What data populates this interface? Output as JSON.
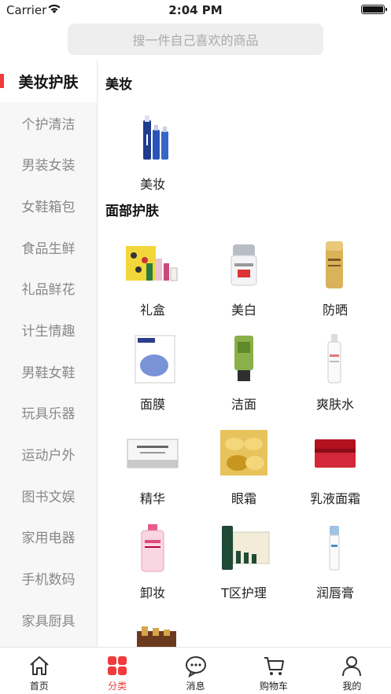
{
  "status_bar": {
    "carrier": "Carrier",
    "time": "2:04 PM"
  },
  "search": {
    "placeholder": "搜一件自己喜欢的商品"
  },
  "sidebar": {
    "items": [
      {
        "label": "美妆护肤",
        "active": true
      },
      {
        "label": "个护清洁"
      },
      {
        "label": "男装女装"
      },
      {
        "label": "女鞋箱包"
      },
      {
        "label": "食品生鲜"
      },
      {
        "label": "礼品鲜花"
      },
      {
        "label": "计生情趣"
      },
      {
        "label": "男鞋女鞋"
      },
      {
        "label": "玩具乐器"
      },
      {
        "label": "运动户外"
      },
      {
        "label": "图书文娱"
      },
      {
        "label": "家用电器"
      },
      {
        "label": "手机数码"
      },
      {
        "label": "家具厨具"
      }
    ]
  },
  "sections": [
    {
      "title": "美妆",
      "items": [
        {
          "label": "美妆"
        }
      ]
    },
    {
      "title": "面部护肤",
      "items": [
        {
          "label": "礼盒"
        },
        {
          "label": "美白"
        },
        {
          "label": "防晒"
        },
        {
          "label": "面膜"
        },
        {
          "label": "洁面"
        },
        {
          "label": "爽肤水"
        },
        {
          "label": "精华"
        },
        {
          "label": "眼霜"
        },
        {
          "label": "乳液面霜"
        },
        {
          "label": "卸妆"
        },
        {
          "label": "T区护理"
        },
        {
          "label": "润唇膏"
        }
      ]
    }
  ],
  "tabbar": {
    "items": [
      {
        "label": "首页",
        "icon": "home-icon"
      },
      {
        "label": "分类",
        "icon": "category-icon",
        "active": true
      },
      {
        "label": "消息",
        "icon": "message-icon"
      },
      {
        "label": "购物车",
        "icon": "cart-icon"
      },
      {
        "label": "我的",
        "icon": "profile-icon"
      }
    ]
  },
  "colors": {
    "accent": "#ef3b3b",
    "sidebar_bg": "#f7f7f7",
    "search_bg": "#eeeeee"
  }
}
